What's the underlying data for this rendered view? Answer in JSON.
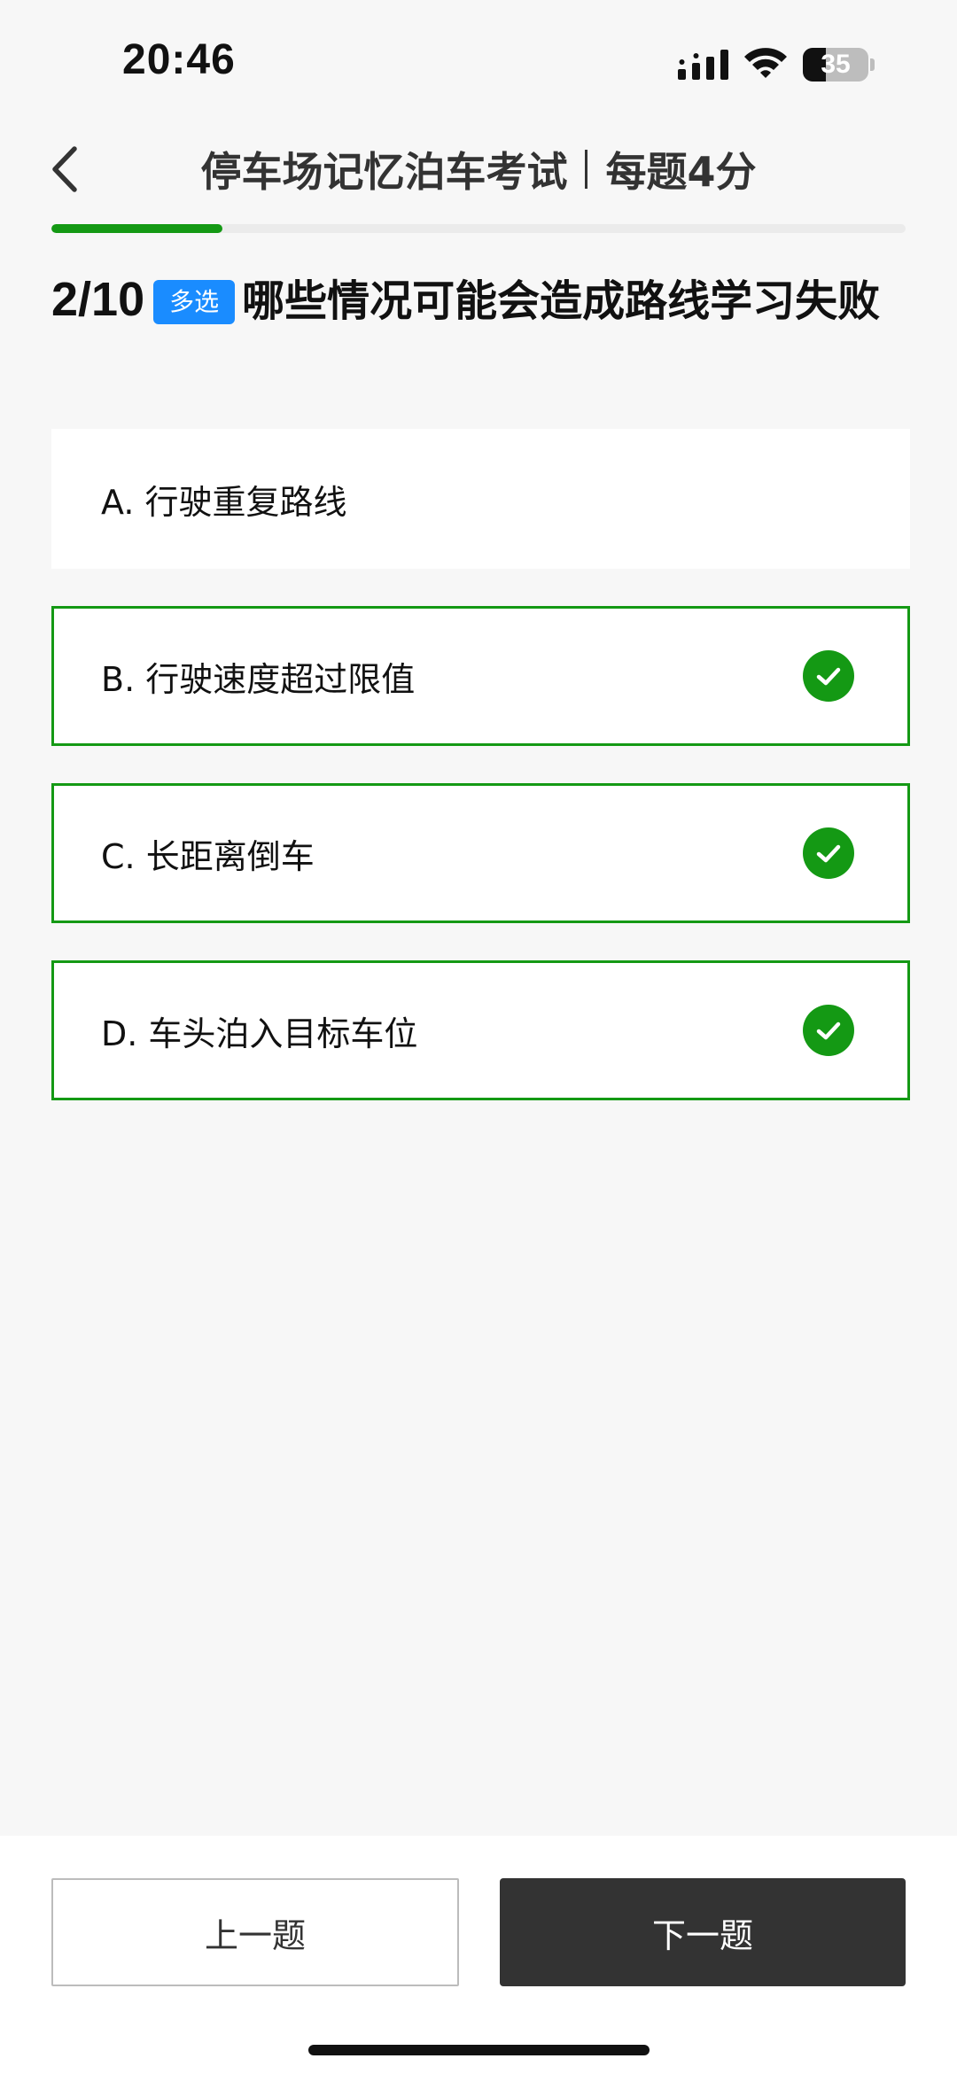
{
  "status_bar": {
    "time": "20:46",
    "battery_level": 35,
    "battery_text": "35",
    "icons": [
      "signal-icon",
      "wifi-icon",
      "battery-icon"
    ]
  },
  "header": {
    "title": "停车场记忆泊车考试",
    "score_text": "每题4分",
    "back_icon": "chevron-left-icon"
  },
  "progress": {
    "current": 2,
    "total": 10
  },
  "question": {
    "number": "2/10",
    "type_badge": "多选",
    "text": "哪些情况可能会造成路线学习失败"
  },
  "options": [
    {
      "label": "A. 行驶重复路线",
      "selected": false
    },
    {
      "label": "B. 行驶速度超过限值",
      "selected": true
    },
    {
      "label": "C. 长距离倒车",
      "selected": true
    },
    {
      "label": "D. 车头泊入目标车位",
      "selected": true
    }
  ],
  "buttons": {
    "prev_label": "上一题",
    "next_label": "下一题"
  },
  "colors": {
    "accent_green": "#149914",
    "badge_blue": "#1a8cff",
    "next_button": "#333333",
    "background": "#f7f7f7"
  }
}
